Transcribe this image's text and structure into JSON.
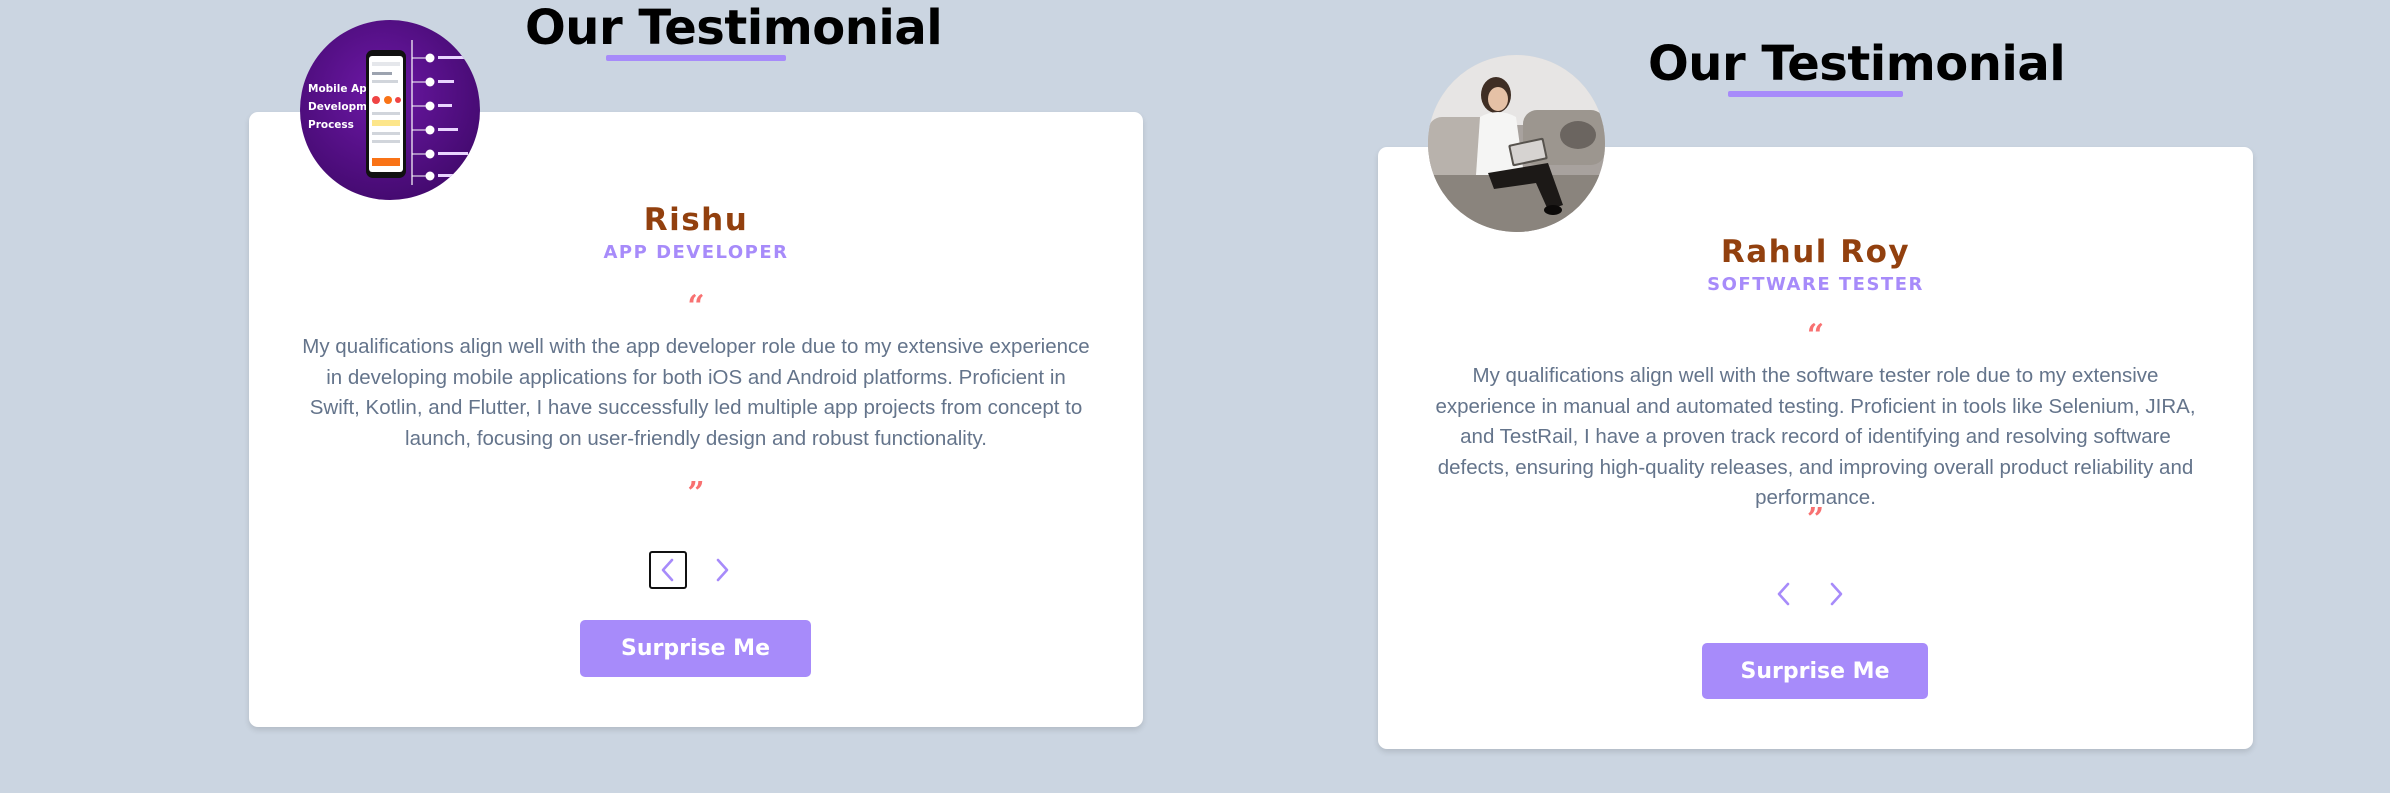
{
  "testimonials": [
    {
      "heading": "Our Testimonial",
      "name": "Rishu",
      "job": "APP DEVELOPER",
      "avatar_alt": "Mobile App Development Process",
      "avatar_lines": [
        "Mobile App",
        "Development",
        "Process"
      ],
      "open_quote": "“",
      "close_quote": "”",
      "text": "My qualifications align well with the app developer role due to my extensive experience in developing mobile applications for both iOS and Android platforms. Proficient in Swift, Kotlin, and Flutter, I have successfully led multiple app projects from concept to launch, focusing on user-friendly design and robust functionality.",
      "button": "Surprise Me"
    },
    {
      "heading": "Our Testimonial",
      "name": "Rahul Roy",
      "job": "SOFTWARE TESTER",
      "open_quote": "“",
      "close_quote": "”",
      "text": "My qualifications align well with the software tester role due to my extensive experience in manual and automated testing. Proficient in tools like Selenium, JIRA, and TestRail, I have a proven track record of identifying and resolving software defects, ensuring high-quality releases, and improving overall product reliability and performance.",
      "button": "Surprise Me"
    }
  ],
  "colors": {
    "background": "#cbd5e1",
    "accent": "#a78bfa",
    "name": "#92400e",
    "quote": "#f87171",
    "body_text": "#64748b"
  },
  "icons": {
    "prev": "chevron-left-icon",
    "next": "chevron-right-icon"
  }
}
